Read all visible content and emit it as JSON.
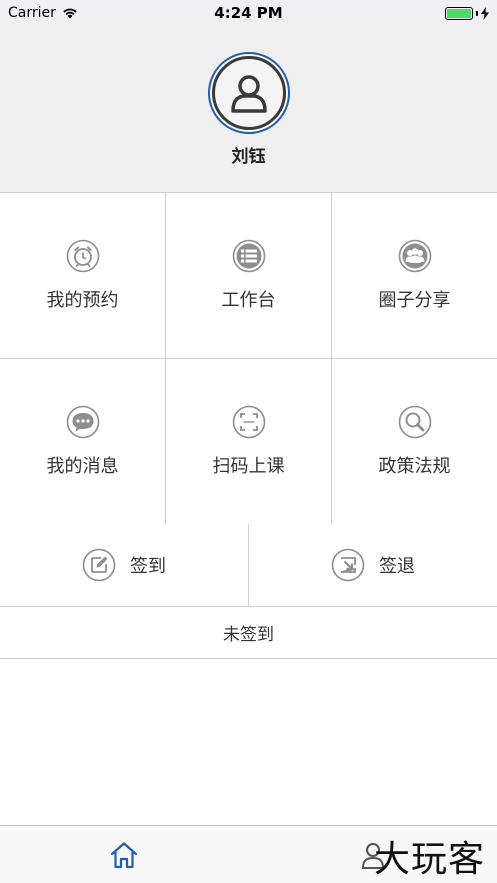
{
  "status_bar": {
    "carrier": "Carrier",
    "time": "4:24 PM"
  },
  "header": {
    "user_name": "刘钰"
  },
  "grid": {
    "items": [
      {
        "label": "我的预约",
        "icon": "alarm-clock-icon"
      },
      {
        "label": "工作台",
        "icon": "list-icon"
      },
      {
        "label": "圈子分享",
        "icon": "group-icon"
      },
      {
        "label": "我的消息",
        "icon": "chat-bubble-icon"
      },
      {
        "label": "扫码上课",
        "icon": "scan-icon"
      },
      {
        "label": "政策法规",
        "icon": "search-icon"
      }
    ]
  },
  "sign": {
    "checkin_label": "签到",
    "checkout_label": "签退",
    "status_text": "未签到"
  },
  "tab_bar": {
    "tabs": [
      {
        "icon": "home-icon"
      },
      {
        "icon": "profile-icon"
      }
    ]
  },
  "watermark": "大玩客",
  "colors": {
    "accent": "#1f5fae",
    "icon_gray": "#8e8e8e",
    "battery": "#4cd964"
  }
}
